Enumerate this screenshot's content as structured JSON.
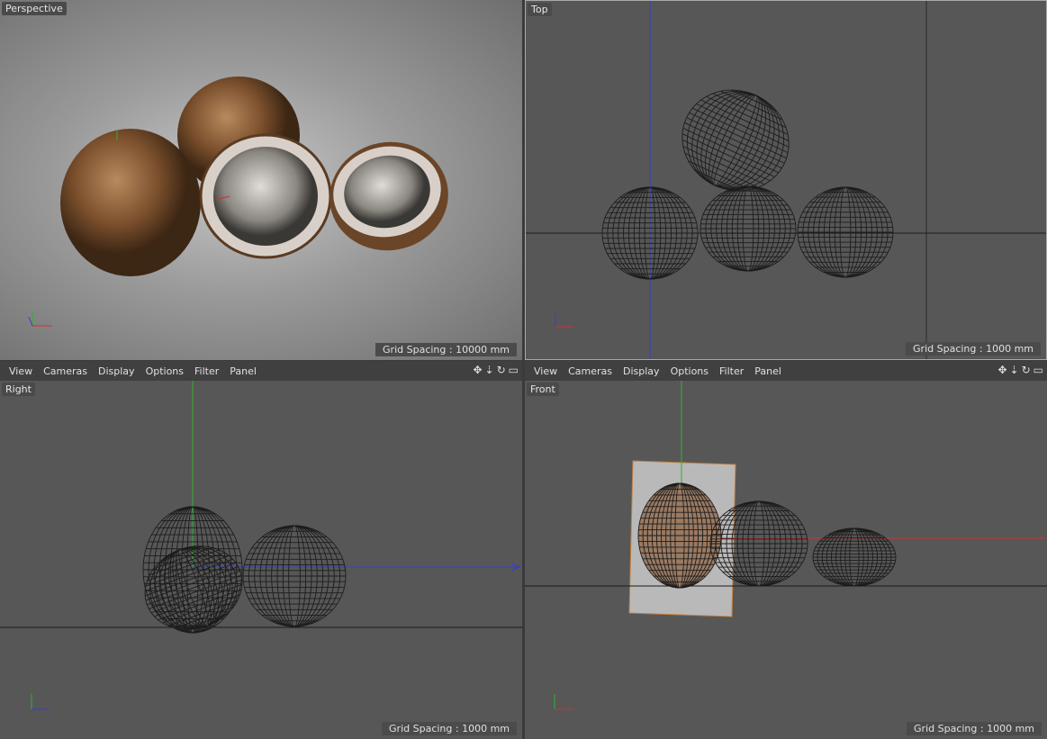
{
  "viewports": {
    "perspective": {
      "label": "Perspective",
      "grid": "Grid Spacing : 10000 mm"
    },
    "top": {
      "label": "Top",
      "grid": "Grid Spacing : 1000 mm"
    },
    "right": {
      "label": "Right",
      "grid": "Grid Spacing : 1000 mm"
    },
    "front": {
      "label": "Front",
      "grid": "Grid Spacing : 1000 mm"
    }
  },
  "menu": {
    "view": "View",
    "cameras": "Cameras",
    "display": "Display",
    "options": "Options",
    "filter": "Filter",
    "panel": "Panel"
  },
  "nav_icons": [
    "move-icon",
    "zoom-icon",
    "rotate-icon",
    "maximize-icon"
  ],
  "axes": {
    "x": "X",
    "y": "Y",
    "z": "Z"
  },
  "colors": {
    "x": "#d23030",
    "y": "#30b030",
    "z": "#3040d0"
  }
}
